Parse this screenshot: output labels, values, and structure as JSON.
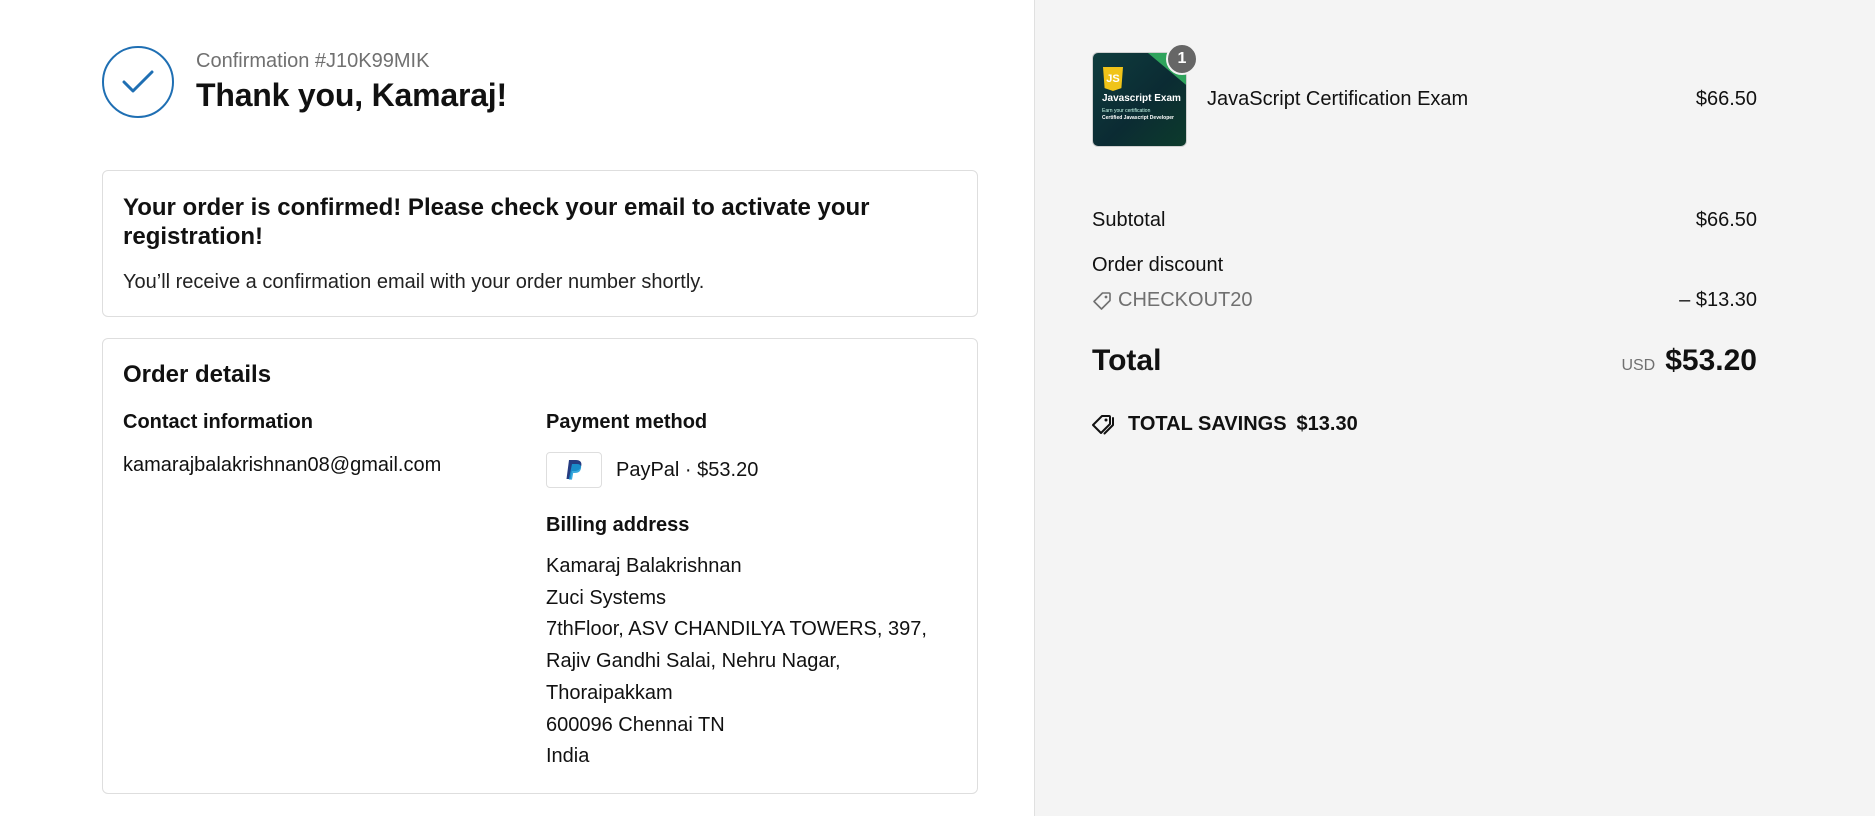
{
  "header": {
    "confirmation": "Confirmation #J10K99MIK",
    "thank_you": "Thank you, Kamaraj!"
  },
  "confirm_card": {
    "title": "Your order is confirmed! Please check your email to activate your registration!",
    "text": "You’ll receive a confirmation email with your order number shortly."
  },
  "order_details": {
    "title": "Order details",
    "contact_heading": "Contact information",
    "contact_email": "kamarajbalakrishnan08@gmail.com",
    "payment_heading": "Payment method",
    "payment_text": "PayPal · $53.20",
    "billing_heading": "Billing address",
    "billing_lines": [
      "Kamaraj Balakrishnan",
      "Zuci Systems",
      "7thFloor, ASV CHANDILYA TOWERS, 397,",
      "Rajiv Gandhi Salai, Nehru Nagar,",
      "Thoraipakkam",
      "600096 Chennai TN",
      "India"
    ]
  },
  "summary": {
    "item": {
      "name": "JavaScript Certification Exam",
      "price": "$66.50",
      "quantity": "1",
      "thumb_js": "JS",
      "thumb_title": "Javascript Exam",
      "thumb_sub": "Earn your certification",
      "thumb_sub2": "Certified Javascript Developer"
    },
    "subtotal_label": "Subtotal",
    "subtotal_value": "$66.50",
    "discount_label": "Order discount",
    "discount_code": "CHECKOUT20",
    "discount_value": "– $13.30",
    "total_label": "Total",
    "currency": "USD",
    "total_value": "$53.20",
    "savings_label": "TOTAL SAVINGS",
    "savings_value": "$13.30"
  },
  "colors": {
    "accent": "#1f6fb3",
    "aside_bg": "#f4f4f4",
    "muted_text": "#707070"
  }
}
